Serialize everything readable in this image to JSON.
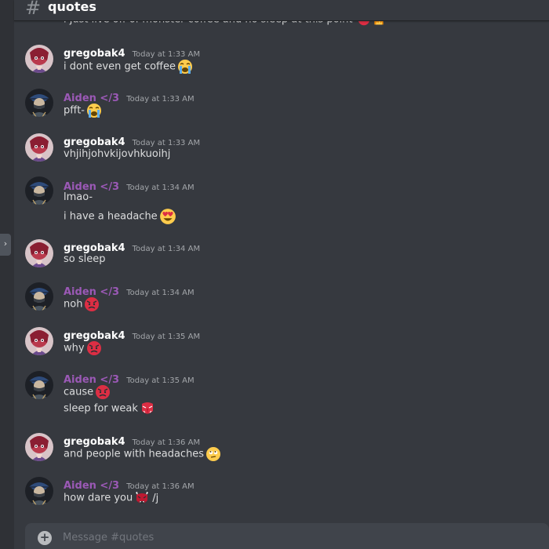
{
  "channel": {
    "name": "quotes"
  },
  "cut_off_message": "i just live off of monster coffee and no sleep at this point",
  "composer": {
    "placeholder": "Message #quotes"
  },
  "colors": {
    "gregobak4": "#ffffff",
    "aiden": "#9b59b6",
    "background": "#36393f"
  },
  "messages": [
    {
      "author": "gregobak4",
      "time": "Today at 1:33 AM",
      "lines": [
        "i dont even get coffee"
      ],
      "emojis": [
        "loudly-crying-emoji"
      ]
    },
    {
      "author": "Aiden </3",
      "time": "Today at 1:33 AM",
      "lines": [
        "pfft-"
      ],
      "emojis": [
        "loudly-crying-emoji"
      ]
    },
    {
      "author": "gregobak4",
      "time": "Today at 1:33 AM",
      "lines": [
        "vhjihjohvkijovhkuoihj"
      ],
      "emojis": []
    },
    {
      "author": "Aiden </3",
      "time": "Today at 1:34 AM",
      "lines": [
        "lmao-",
        "i have a headache"
      ],
      "emojis": [
        "heart-eyes-emoji"
      ]
    },
    {
      "author": "gregobak4",
      "time": "Today at 1:34 AM",
      "lines": [
        "so sleep"
      ],
      "emojis": []
    },
    {
      "author": "Aiden </3",
      "time": "Today at 1:34 AM",
      "lines": [
        "noh"
      ],
      "emojis": [
        "angry-face-emoji"
      ]
    },
    {
      "author": "gregobak4",
      "time": "Today at 1:35 AM",
      "lines": [
        "why"
      ],
      "emojis": [
        "angry-face-emoji"
      ]
    },
    {
      "author": "Aiden </3",
      "time": "Today at 1:35 AM",
      "lines": [
        "cause",
        "sleep for weak"
      ],
      "emojis": [
        "angry-face-emoji",
        "tengu-emoji"
      ]
    },
    {
      "author": "gregobak4",
      "time": "Today at 1:36 AM",
      "lines": [
        "and people with headaches"
      ],
      "emojis": [
        "rolling-eyes-emoji"
      ]
    },
    {
      "author": "Aiden </3",
      "time": "Today at 1:36 AM",
      "lines": [
        "how dare you",
        "/j"
      ],
      "emojis": [
        "ogre-emoji"
      ]
    }
  ]
}
